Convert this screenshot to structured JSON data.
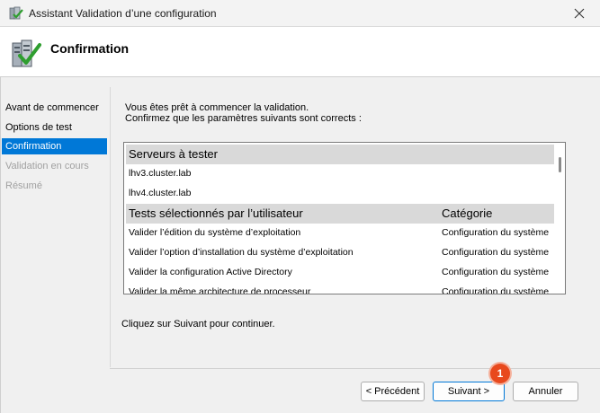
{
  "window": {
    "title": "Assistant Validation d’une configuration",
    "app_icon": "server-check-icon",
    "close_icon": "close-icon"
  },
  "header": {
    "title": "Confirmation",
    "icon": "server-validation-icon"
  },
  "sidebar": {
    "items": [
      {
        "label": "Avant de commencer",
        "state": "normal"
      },
      {
        "label": "Options de test",
        "state": "normal"
      },
      {
        "label": "Confirmation",
        "state": "active"
      },
      {
        "label": "Validation en cours",
        "state": "disabled"
      },
      {
        "label": "Résumé",
        "state": "disabled"
      }
    ]
  },
  "main": {
    "intro_line1": "Vous êtes prêt à commencer la validation.",
    "intro_line2": "Confirmez que les paramètres suivants sont corrects :",
    "servers_header": "Serveurs à tester",
    "servers": [
      "lhv3.cluster.lab",
      "lhv4.cluster.lab"
    ],
    "tests_header": "Tests sélectionnés par l’utilisateur",
    "category_header": "Catégorie",
    "tests": [
      {
        "name": "Valider l’édition du système d’exploitation",
        "category": "Configuration du système"
      },
      {
        "name": "Valider l’option d’installation du système d’exploitation",
        "category": "Configuration du système"
      },
      {
        "name": "Valider la configuration Active Directory",
        "category": "Configuration du système"
      },
      {
        "name": "Valider la même architecture de processeur",
        "category": "Configuration du système"
      }
    ],
    "footer_text": "Cliquez sur Suivant pour continuer."
  },
  "buttons": {
    "previous": "< Précédent",
    "next": "Suivant >",
    "cancel": "Annuler"
  },
  "annotation": {
    "badge_number": "1",
    "badge_color": "#e8491d"
  },
  "colors": {
    "accent": "#0078d7",
    "section_header_bg": "#d9d9d9"
  }
}
